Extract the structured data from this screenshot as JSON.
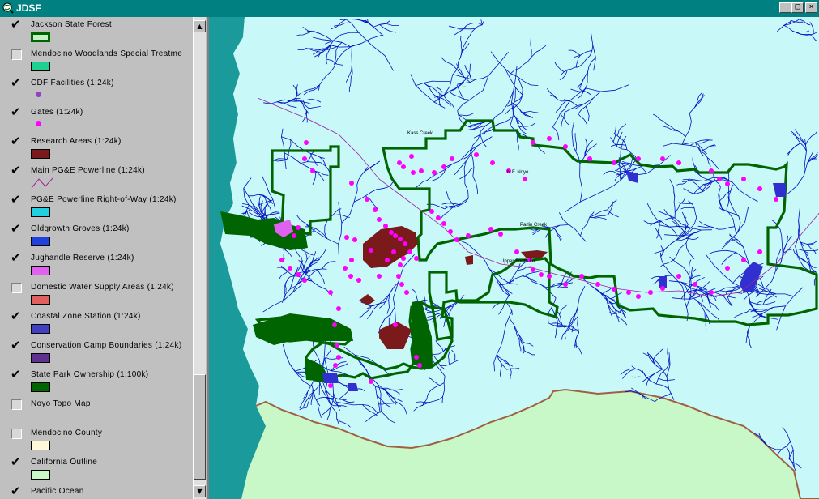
{
  "window": {
    "title": "JDSF",
    "minimize_glyph": "_",
    "maximize_glyph": "□",
    "close_glyph": "×"
  },
  "toc": {
    "scroll_up_glyph": "▲",
    "scroll_down_glyph": "▼",
    "layers": [
      {
        "label": "Jackson State Forest",
        "checked": true,
        "symbol": "outline",
        "fill": "#c8f0c8",
        "stroke": "#006400"
      },
      {
        "label": "Mendocino Woodlands Special Treatme",
        "checked": false,
        "symbol": "fill",
        "fill": "#20d090"
      },
      {
        "label": "CDF Facilities (1:24k)",
        "checked": true,
        "symbol": "dot",
        "fill": "#9040c0"
      },
      {
        "label": "Gates (1:24k)",
        "checked": true,
        "symbol": "dot",
        "fill": "#ff00ff"
      },
      {
        "label": "Research Areas (1:24k)",
        "checked": true,
        "symbol": "fill",
        "fill": "#7a1a1a"
      },
      {
        "label": "Main PG&E Powerline (1:24k)",
        "checked": true,
        "symbol": "line",
        "fill": "#a020a0"
      },
      {
        "label": "PG&E Powerline Right-of-Way (1:24k)",
        "checked": true,
        "symbol": "fill",
        "fill": "#20d0e0"
      },
      {
        "label": "Oldgrowth Groves (1:24k)",
        "checked": true,
        "symbol": "fill",
        "fill": "#2040e0"
      },
      {
        "label": "Jughandle Reserve (1:24k)",
        "checked": true,
        "symbol": "fill",
        "fill": "#e060f0"
      },
      {
        "label": "Domestic Water Supply Areas (1:24k)",
        "checked": false,
        "symbol": "fill",
        "fill": "#e06060"
      },
      {
        "label": "Coastal Zone Station (1:24k)",
        "checked": true,
        "symbol": "fill",
        "fill": "#4040c0"
      },
      {
        "label": "Conservation Camp Boundaries (1:24k)",
        "checked": true,
        "symbol": "fill",
        "fill": "#603090"
      },
      {
        "label": "State Park Ownership (1:100k)",
        "checked": true,
        "symbol": "fill",
        "fill": "#006400"
      },
      {
        "label": "Noyo Topo Map",
        "checked": false,
        "symbol": "none"
      },
      {
        "label": "Mendocino County",
        "checked": false,
        "symbol": "fill",
        "fill": "#fff8d8"
      },
      {
        "label": "California Outline",
        "checked": true,
        "symbol": "fill",
        "fill": "#c8f8c8"
      },
      {
        "label": "Pacific Ocean",
        "checked": true,
        "symbol": "none"
      }
    ]
  },
  "map": {
    "colors": {
      "ocean": "#1a9a9a",
      "land": "#c8f8c8",
      "watershed": "#c8f8f8",
      "streams": "#0010c0",
      "forest_boundary": "#006400",
      "gates": "#ff00ff",
      "research": "#7a1a1a",
      "powerline": "#a020a0",
      "county_line": "#a06040"
    },
    "place_labels": [
      "Kass Creek",
      "N.F. Noyo",
      "Parlin Creek",
      "Upper South Fo"
    ]
  }
}
